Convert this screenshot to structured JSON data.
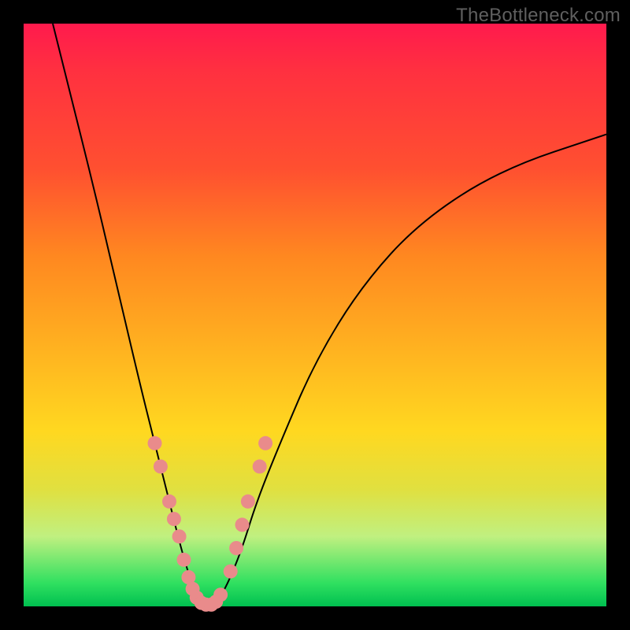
{
  "watermark": "TheBottleneck.com",
  "chart_data": {
    "type": "line",
    "title": "",
    "xlabel": "",
    "ylabel": "",
    "xlim": [
      0,
      100
    ],
    "ylim": [
      0,
      100
    ],
    "series": [
      {
        "name": "left-branch",
        "x": [
          5,
          8,
          12,
          16,
          20,
          22.5,
          25,
          27,
          28.5,
          29.5,
          30
        ],
        "y": [
          100,
          88,
          72,
          55,
          38,
          28,
          18,
          10,
          5,
          2,
          0
        ]
      },
      {
        "name": "right-branch",
        "x": [
          33,
          34,
          35.5,
          37.5,
          40,
          44,
          50,
          58,
          68,
          82,
          100
        ],
        "y": [
          0,
          2,
          5,
          10,
          18,
          28,
          42,
          55,
          66,
          75,
          81
        ]
      }
    ],
    "markers": {
      "name": "highlighted-points",
      "points": [
        {
          "x": 22.5,
          "y": 28
        },
        {
          "x": 23.5,
          "y": 24
        },
        {
          "x": 25.0,
          "y": 18
        },
        {
          "x": 25.8,
          "y": 15
        },
        {
          "x": 26.7,
          "y": 12
        },
        {
          "x": 27.5,
          "y": 8
        },
        {
          "x": 28.3,
          "y": 5
        },
        {
          "x": 29.0,
          "y": 3
        },
        {
          "x": 29.7,
          "y": 1.5
        },
        {
          "x": 30.5,
          "y": 0.6
        },
        {
          "x": 31.3,
          "y": 0.3
        },
        {
          "x": 32.2,
          "y": 0.3
        },
        {
          "x": 33.0,
          "y": 0.8
        },
        {
          "x": 33.8,
          "y": 2
        },
        {
          "x": 35.5,
          "y": 6
        },
        {
          "x": 36.5,
          "y": 10
        },
        {
          "x": 37.5,
          "y": 14
        },
        {
          "x": 38.5,
          "y": 18
        },
        {
          "x": 40.5,
          "y": 24
        },
        {
          "x": 41.5,
          "y": 28
        }
      ]
    },
    "background": {
      "style": "vertical-gradient",
      "stops": [
        {
          "pos": 0,
          "color": "#ff1a4d"
        },
        {
          "pos": 40,
          "color": "#ff8820"
        },
        {
          "pos": 75,
          "color": "#ffe020"
        },
        {
          "pos": 100,
          "color": "#00c050"
        }
      ]
    }
  }
}
